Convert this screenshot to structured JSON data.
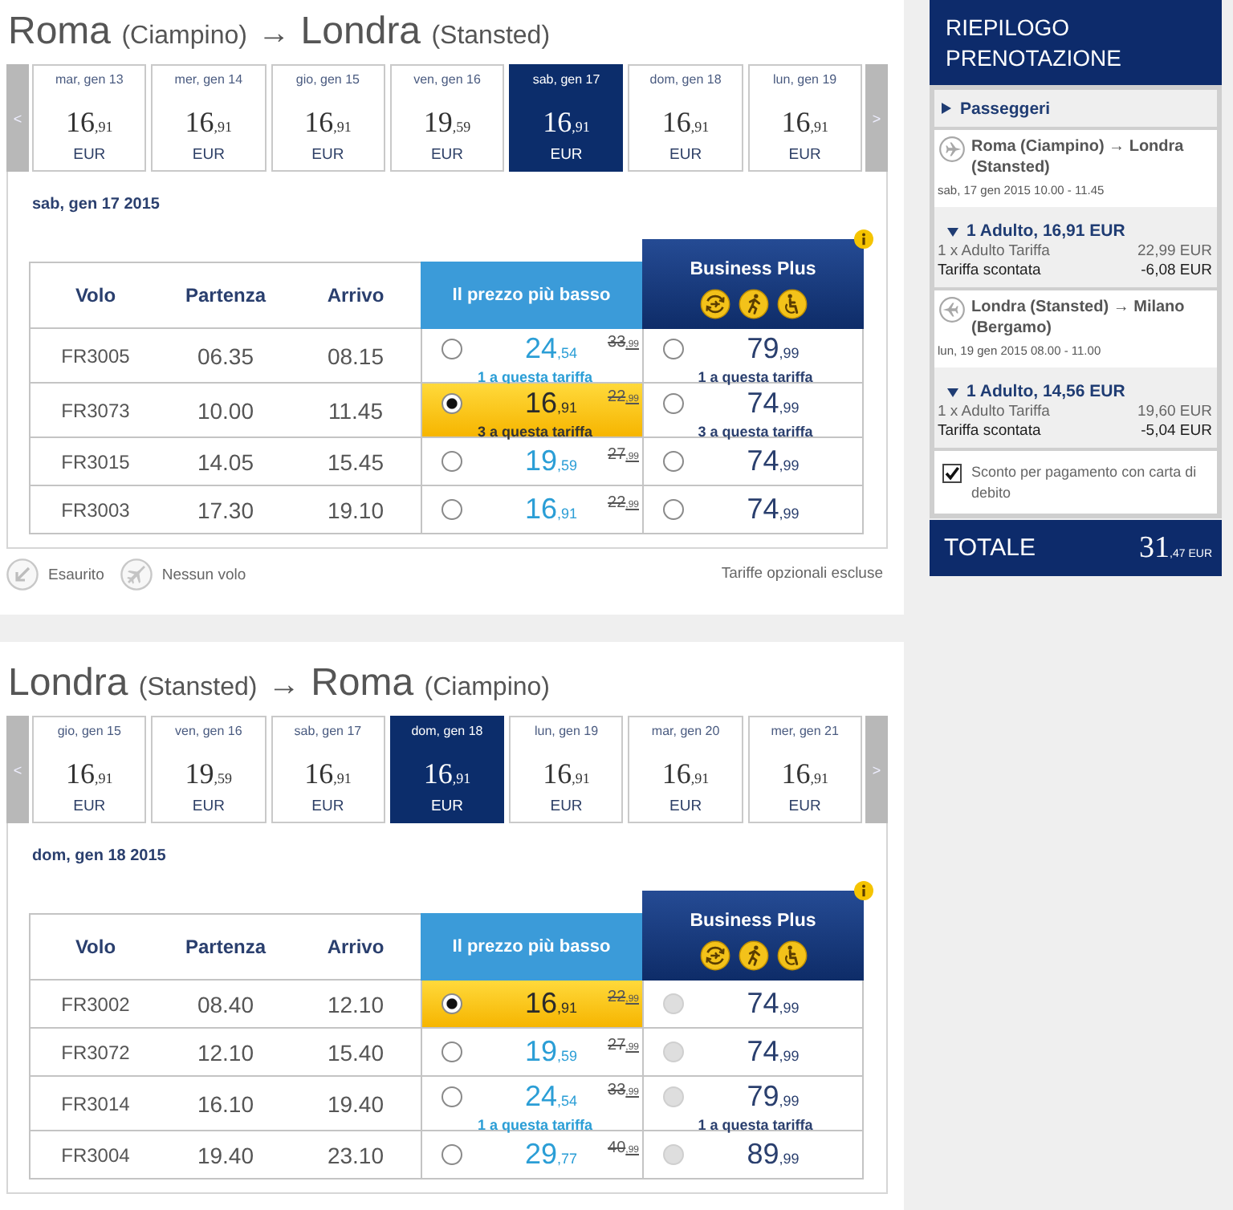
{
  "journeys": [
    {
      "origin": "Roma",
      "origin_airport": "(Ciampino)",
      "arrow": "→",
      "destination": "Londra",
      "destination_airport": "(Stansted)",
      "prev": "<",
      "next": ">",
      "dates": [
        {
          "label": "mar, gen 13",
          "price": "16",
          "cents": ",91",
          "currency": "EUR",
          "selected": false
        },
        {
          "label": "mer, gen 14",
          "price": "16",
          "cents": ",91",
          "currency": "EUR",
          "selected": false
        },
        {
          "label": "gio, gen 15",
          "price": "16",
          "cents": ",91",
          "currency": "EUR",
          "selected": false
        },
        {
          "label": "ven, gen 16",
          "price": "19",
          "cents": ",59",
          "currency": "EUR",
          "selected": false
        },
        {
          "label": "sab, gen 17",
          "price": "16",
          "cents": ",91",
          "currency": "EUR",
          "selected": true
        },
        {
          "label": "dom, gen 18",
          "price": "16",
          "cents": ",91",
          "currency": "EUR",
          "selected": false
        },
        {
          "label": "lun, gen 19",
          "price": "16",
          "cents": ",91",
          "currency": "EUR",
          "selected": false
        }
      ],
      "day_heading": "sab, gen 17 2015",
      "columns": [
        "Volo",
        "Partenza",
        "Arrivo"
      ],
      "lowest_header": "Il prezzo più basso",
      "business_header": "Business Plus",
      "flights": [
        {
          "number": "FR3005",
          "departure": "06.35",
          "arrival": "08.15",
          "lowest": {
            "price": "24",
            "cents": ",54",
            "old_price": "33",
            "old_cents": ",99",
            "availability": "1 a questa tariffa",
            "selected": false
          },
          "business": {
            "price": "79",
            "cents": ",99",
            "availability": "1 a questa tariffa",
            "selected": false,
            "disabled": false
          }
        },
        {
          "number": "FR3073",
          "departure": "10.00",
          "arrival": "11.45",
          "lowest": {
            "price": "16",
            "cents": ",91",
            "old_price": "22",
            "old_cents": ",99",
            "availability": "3 a questa tariffa",
            "selected": true
          },
          "business": {
            "price": "74",
            "cents": ",99",
            "availability": "3 a questa tariffa",
            "selected": false,
            "disabled": false
          }
        },
        {
          "number": "FR3015",
          "departure": "14.05",
          "arrival": "15.45",
          "lowest": {
            "price": "19",
            "cents": ",59",
            "old_price": "27",
            "old_cents": ",99",
            "selected": false
          },
          "business": {
            "price": "74",
            "cents": ",99",
            "selected": false,
            "disabled": false
          }
        },
        {
          "number": "FR3003",
          "departure": "17.30",
          "arrival": "19.10",
          "lowest": {
            "price": "16",
            "cents": ",91",
            "old_price": "22",
            "old_cents": ",99",
            "selected": false
          },
          "business": {
            "price": "74",
            "cents": ",99",
            "selected": false,
            "disabled": false
          }
        }
      ],
      "legend": [
        {
          "kind": "sold-out",
          "label": "Esaurito"
        },
        {
          "kind": "no-flight",
          "label": "Nessun volo"
        }
      ],
      "note": "Tariffe opzionali escluse"
    },
    {
      "origin": "Londra",
      "origin_airport": "(Stansted)",
      "arrow": "→",
      "destination": "Roma",
      "destination_airport": "(Ciampino)",
      "prev": "<",
      "next": ">",
      "dates": [
        {
          "label": "gio, gen 15",
          "price": "16",
          "cents": ",91",
          "currency": "EUR",
          "selected": false
        },
        {
          "label": "ven, gen 16",
          "price": "19",
          "cents": ",59",
          "currency": "EUR",
          "selected": false
        },
        {
          "label": "sab, gen 17",
          "price": "16",
          "cents": ",91",
          "currency": "EUR",
          "selected": false
        },
        {
          "label": "dom, gen 18",
          "price": "16",
          "cents": ",91",
          "currency": "EUR",
          "selected": true
        },
        {
          "label": "lun, gen 19",
          "price": "16",
          "cents": ",91",
          "currency": "EUR",
          "selected": false
        },
        {
          "label": "mar, gen 20",
          "price": "16",
          "cents": ",91",
          "currency": "EUR",
          "selected": false
        },
        {
          "label": "mer, gen 21",
          "price": "16",
          "cents": ",91",
          "currency": "EUR",
          "selected": false
        }
      ],
      "day_heading": "dom, gen 18 2015",
      "columns": [
        "Volo",
        "Partenza",
        "Arrivo"
      ],
      "lowest_header": "Il prezzo più basso",
      "business_header": "Business Plus",
      "flights": [
        {
          "number": "FR3002",
          "departure": "08.40",
          "arrival": "12.10",
          "lowest": {
            "price": "16",
            "cents": ",91",
            "old_price": "22",
            "old_cents": ",99",
            "selected": true
          },
          "business": {
            "price": "74",
            "cents": ",99",
            "selected": false,
            "disabled": true
          }
        },
        {
          "number": "FR3072",
          "departure": "12.10",
          "arrival": "15.40",
          "lowest": {
            "price": "19",
            "cents": ",59",
            "old_price": "27",
            "old_cents": ",99",
            "selected": false
          },
          "business": {
            "price": "74",
            "cents": ",99",
            "selected": false,
            "disabled": true
          }
        },
        {
          "number": "FR3014",
          "departure": "16.10",
          "arrival": "19.40",
          "lowest": {
            "price": "24",
            "cents": ",54",
            "old_price": "33",
            "old_cents": ",99",
            "availability": "1 a questa tariffa",
            "selected": false
          },
          "business": {
            "price": "79",
            "cents": ",99",
            "availability": "1 a questa tariffa",
            "selected": false,
            "disabled": true
          }
        },
        {
          "number": "FR3004",
          "departure": "19.40",
          "arrival": "23.10",
          "lowest": {
            "price": "29",
            "cents": ",77",
            "old_price": "40",
            "old_cents": ",99",
            "selected": false
          },
          "business": {
            "price": "89",
            "cents": ",99",
            "selected": false,
            "disabled": true
          }
        }
      ]
    }
  ],
  "summary": {
    "title": "RIEPILOGO PRENOTAZIONE",
    "passengers": {
      "label": "Passeggeri",
      "expanded": false
    },
    "legs": [
      {
        "kind": "outbound",
        "route": "Roma (Ciampino) → Londra (Stansted)",
        "schedule": "sab, 17 gen 2015 10.00 - 11.45",
        "fare": {
          "heading": "1 Adulto, 16,91 EUR",
          "expanded": true,
          "lines": [
            {
              "kind": "fare",
              "label": "1 x Adulto Tariffa",
              "amount": "22,99 EUR"
            },
            {
              "kind": "discount",
              "label": "Tariffa scontata",
              "amount": "-6,08 EUR"
            }
          ]
        }
      },
      {
        "kind": "return",
        "route": "Londra (Stansted) → Milano (Bergamo)",
        "schedule": "lun, 19 gen 2015 08.00 - 11.00",
        "fare": {
          "heading": "1 Adulto, 14,56 EUR",
          "expanded": true,
          "lines": [
            {
              "kind": "fare",
              "label": "1 x Adulto Tariffa",
              "amount": "19,60 EUR"
            },
            {
              "kind": "discount",
              "label": "Tariffa scontata",
              "amount": "-5,04 EUR"
            }
          ]
        }
      }
    ],
    "debit_discount": {
      "label": "Sconto per pagamento con carta di debito",
      "checked": true
    },
    "total": {
      "label": "TOTALE",
      "amount": "31",
      "cents": ",47",
      "currency": "EUR"
    }
  }
}
